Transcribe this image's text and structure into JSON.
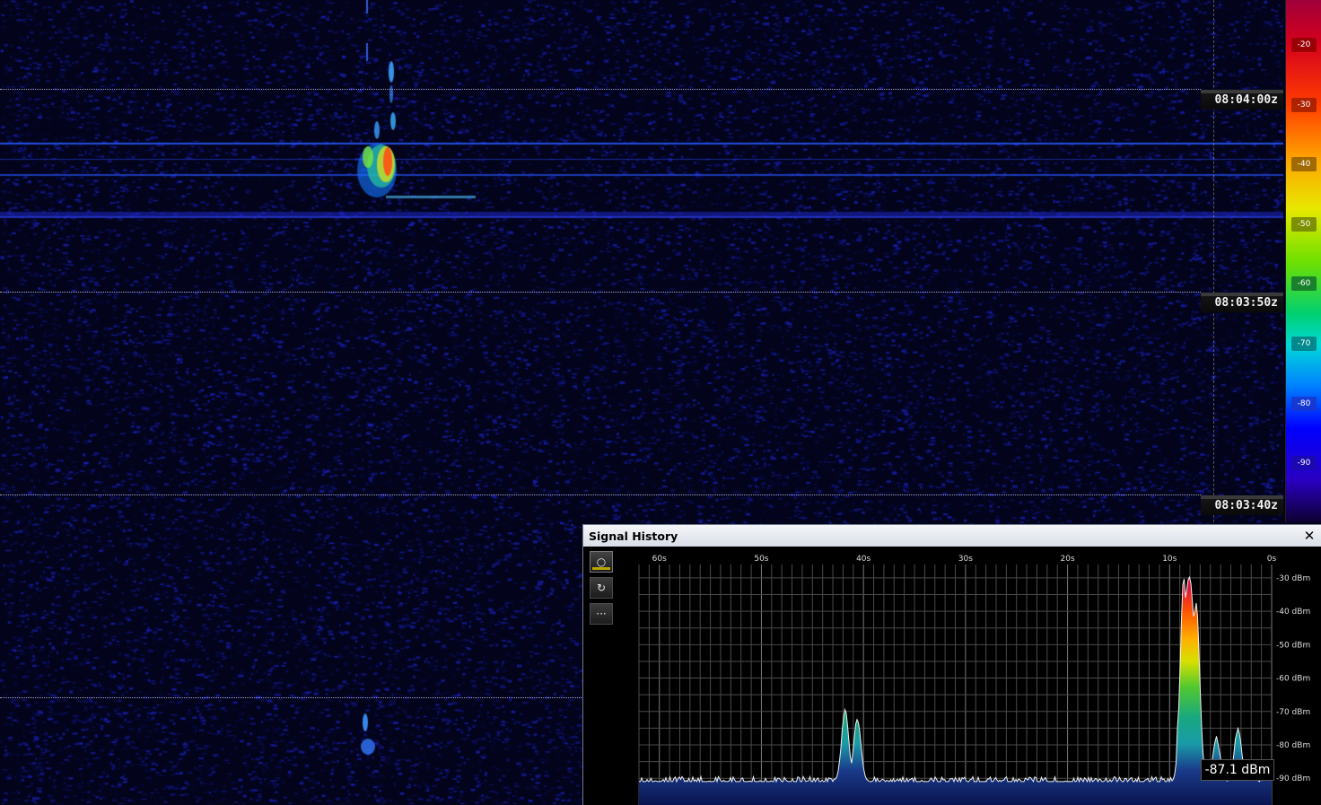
{
  "waterfall": {
    "time_labels": [
      "08:04:00z",
      "08:03:50z",
      "08:03:40z"
    ],
    "color_scale": {
      "ticks": [
        "-20",
        "-30",
        "-40",
        "-50",
        "-60",
        "-70",
        "-80",
        "-90"
      ],
      "tick_colors": [
        "#8b0000",
        "#9a1c00",
        "#8a5a00",
        "#6a7a00",
        "#0f6a2a",
        "#00757a",
        "#1a35c8",
        "#1c0aa8"
      ]
    }
  },
  "signal_history": {
    "title": "Signal History",
    "close_icon": "close-icon",
    "tools": [
      {
        "name": "record-toggle",
        "glyph": "○",
        "active": true
      },
      {
        "name": "reset",
        "glyph": "↻",
        "active": false
      },
      {
        "name": "more-options",
        "glyph": "···",
        "active": false
      }
    ],
    "readout": "-87.1 dBm",
    "chart_data": {
      "type": "area",
      "x_tick_labels": [
        "60s",
        "50s",
        "40s",
        "30s",
        "20s",
        "10s",
        "0s"
      ],
      "y_tick_labels": [
        "-30 dBm",
        "-40 dBm",
        "-50 dBm",
        "-60 dBm",
        "-70 dBm",
        "-80 dBm",
        "-90 dBm"
      ],
      "xlim": [
        62,
        0
      ],
      "ylim": [
        -98,
        -26
      ],
      "grid": true,
      "noise_floor_dbm": -91,
      "peaks": [
        {
          "t": 41.8,
          "dbm": -70
        },
        {
          "t": 40.6,
          "dbm": -72
        },
        {
          "t": 8.6,
          "dbm": -30
        },
        {
          "t": 7.9,
          "dbm": -33
        },
        {
          "t": 7.4,
          "dbm": -37
        },
        {
          "t": 5.4,
          "dbm": -78
        },
        {
          "t": 3.3,
          "dbm": -75
        }
      ],
      "current_dbm": -87.1
    }
  }
}
